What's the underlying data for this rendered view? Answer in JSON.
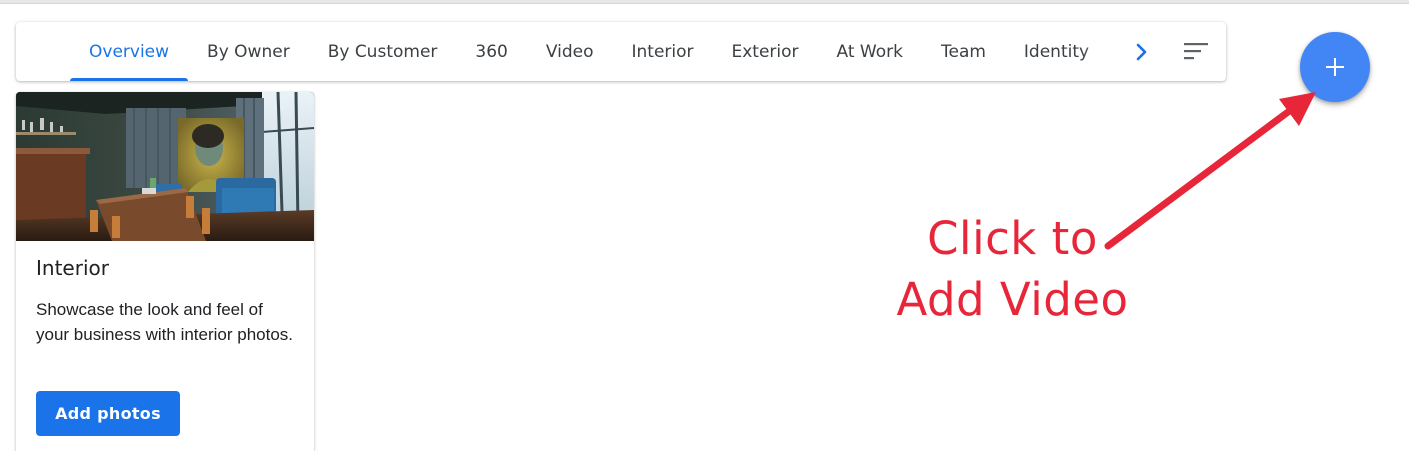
{
  "tabs": [
    {
      "label": "Overview",
      "active": true
    },
    {
      "label": "By Owner"
    },
    {
      "label": "By Customer"
    },
    {
      "label": "360"
    },
    {
      "label": "Video"
    },
    {
      "label": "Interior"
    },
    {
      "label": "Exterior"
    },
    {
      "label": "At Work"
    },
    {
      "label": "Team"
    },
    {
      "label": "Identity"
    }
  ],
  "card": {
    "title": "Interior",
    "description": "Showcase the look and feel of your business with interior photos.",
    "button_label": "Add photos"
  },
  "annotation": {
    "line1": "Click to",
    "line2": "Add Video",
    "color": "#e8263a"
  },
  "colors": {
    "accent": "#1a73e8",
    "fab": "#4285f4"
  },
  "icons": {
    "tabs_next": "chevron-right-icon",
    "sort": "sort-icon",
    "fab": "plus-icon"
  }
}
